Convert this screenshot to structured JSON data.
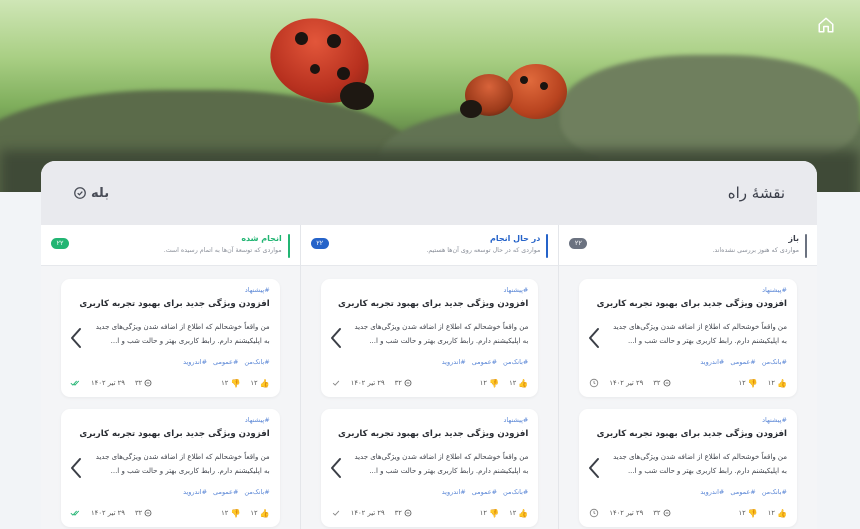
{
  "header": {
    "home_icon": "home-icon"
  },
  "panel": {
    "title": "نقشهٔ راه",
    "yes_label": "بله"
  },
  "columns": [
    {
      "title": "باز",
      "subtitle": "مواردی که هنوز بررسی نشده‌اند.",
      "count": "۲۲",
      "color": "#6b7280",
      "status_icon": "clock-icon"
    },
    {
      "title": "در حال انجام",
      "subtitle": "مواردی که در حال توسعه روی آن‌ها هستیم.",
      "count": "۲۲",
      "color": "#2563c9",
      "status_icon": "check-icon"
    },
    {
      "title": "انجام شده",
      "subtitle": "مواردی که توسعهٔ آن‌ها به اتمام رسیده است.",
      "count": "۲۲",
      "color": "#22b573",
      "status_icon": "double-check-icon"
    }
  ],
  "card": {
    "tag": "#پیشنهاد",
    "title": "افزودن ویژگی جدید برای بهبود تجربه کاربری",
    "body": "من واقعاً خوشحالم که اطلاع از اضافه شدن ویژگی‌های جدید به اپلیکیشنم دارم. رابط کاربری بهتر و حالت شب و ا...",
    "tags": [
      "#بانک‌من",
      "#عمومی",
      "#اندروید"
    ],
    "likes": "۱۲",
    "dislikes": "۱۲",
    "comments": "۳۲",
    "date": "۲۹ تیر ۱۴۰۲"
  }
}
